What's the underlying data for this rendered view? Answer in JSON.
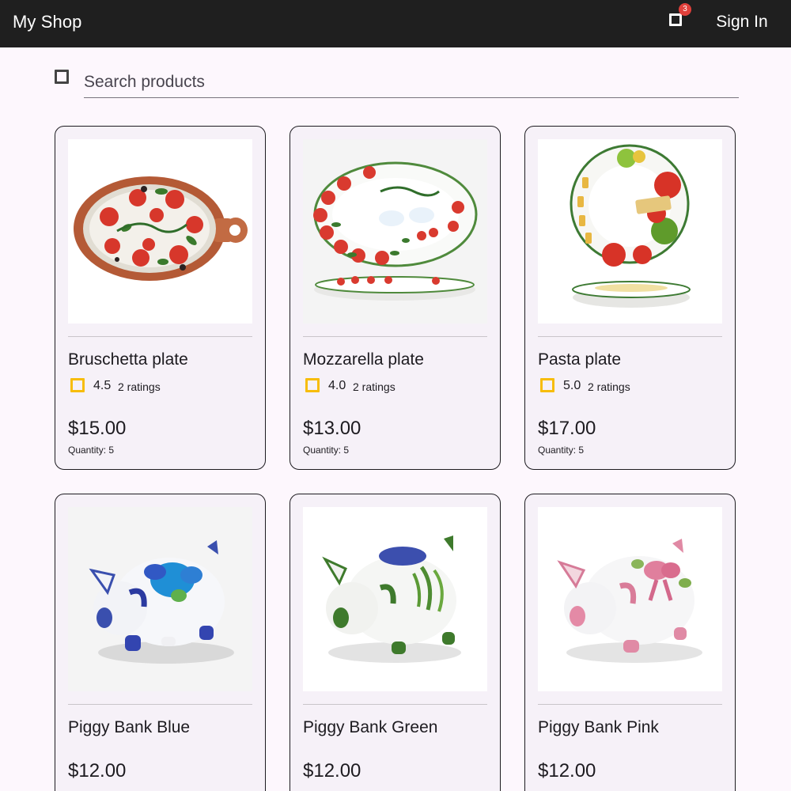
{
  "header": {
    "brand": "My Shop",
    "cart_count": "3",
    "sign_in_label": "Sign In"
  },
  "search": {
    "icon": "search-icon",
    "placeholder": "Search products",
    "value": ""
  },
  "colors": {
    "topbar": "#1f1f1f",
    "page_background": "#fdf7fd",
    "card_background": "#f6f1f8",
    "star": "#f7bd0b",
    "badge": "#e0403b"
  },
  "products": [
    {
      "title": "Bruschetta plate",
      "rating": "4.5",
      "ratings_label": "2 ratings",
      "price": "$15.00",
      "quantity": "Quantity: 5",
      "image": "bruschetta-plate-image"
    },
    {
      "title": "Mozzarella plate",
      "rating": "4.0",
      "ratings_label": "2 ratings",
      "price": "$13.00",
      "quantity": "Quantity: 5",
      "image": "mozzarella-plate-image"
    },
    {
      "title": "Pasta plate",
      "rating": "5.0",
      "ratings_label": "2 ratings",
      "price": "$17.00",
      "quantity": "Quantity: 5",
      "image": "pasta-plate-image"
    },
    {
      "title": "Piggy Bank Blue",
      "price": "$12.00",
      "image": "piggy-bank-blue-image"
    },
    {
      "title": "Piggy Bank Green",
      "price": "$12.00",
      "image": "piggy-bank-green-image"
    },
    {
      "title": "Piggy Bank Pink",
      "price": "$12.00",
      "image": "piggy-bank-pink-image"
    }
  ]
}
